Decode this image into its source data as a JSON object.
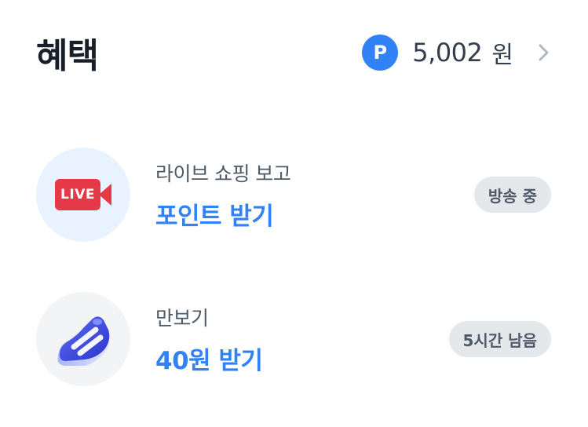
{
  "header": {
    "title": "혜택",
    "points_badge": "P",
    "points_amount": "5,002",
    "points_unit": "원"
  },
  "items": [
    {
      "subtitle": "라이브 쇼핑 보고",
      "title": "포인트 받기",
      "badge": "방송 중",
      "icon_label": "LIVE",
      "icon": "live-camera-icon"
    },
    {
      "subtitle": "만보기",
      "title": "40원 받기",
      "badge": "5시간 남음",
      "icon": "sneaker-icon"
    }
  ],
  "colors": {
    "accent": "#3182f6",
    "title": "#191f28",
    "live_red": "#e53848",
    "pill_bg": "#e5e8eb"
  }
}
